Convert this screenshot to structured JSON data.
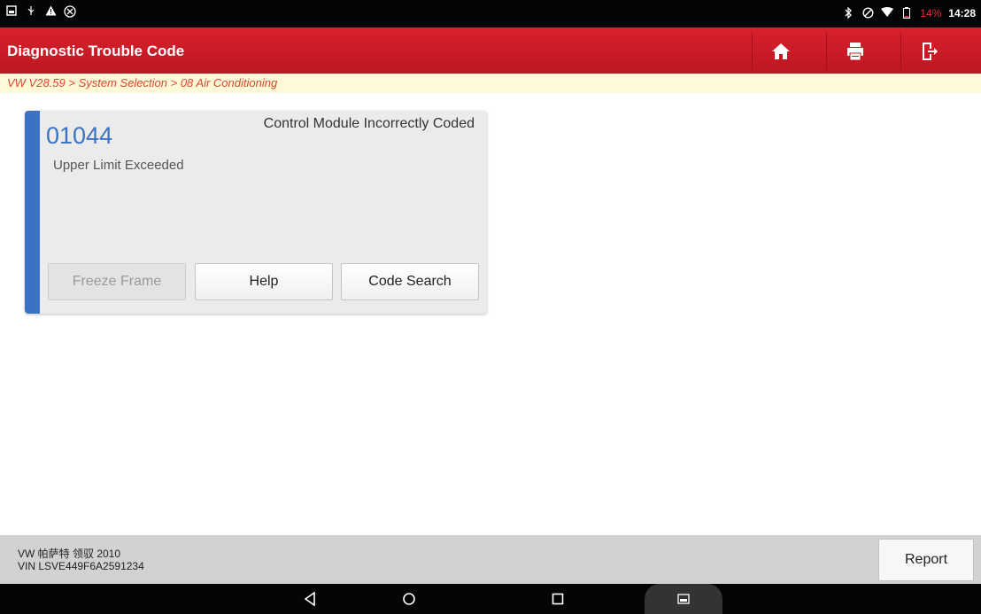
{
  "status_bar": {
    "left_icons": [
      "gallery-icon",
      "usb-icon",
      "warning-icon",
      "blocked-icon"
    ],
    "right_icons": [
      "bluetooth-icon",
      "do-not-disturb-icon",
      "wifi-icon",
      "battery-icon"
    ],
    "battery_percent": "14%",
    "time": "14:28"
  },
  "header": {
    "title": "Diagnostic Trouble Code",
    "buttons": [
      {
        "name": "home",
        "icon": "home-icon"
      },
      {
        "name": "print",
        "icon": "print-icon"
      },
      {
        "name": "exit",
        "icon": "exit-icon"
      }
    ]
  },
  "breadcrumb": "VW V28.59 > System Selection > 08 Air Conditioning",
  "dtc": {
    "code": "01044",
    "title": "Control Module Incorrectly Coded",
    "status": "Upper Limit Exceeded",
    "buttons": {
      "freeze_frame": "Freeze Frame",
      "help": "Help",
      "code_search": "Code Search"
    }
  },
  "footer": {
    "vehicle": "VW 帕萨特 领驭 2010",
    "vin": "VIN LSVE449F6A2591234",
    "report_label": "Report"
  },
  "navigation": {
    "buttons": [
      "back-icon",
      "home-circle-icon",
      "recents-icon",
      "screenshot-icon"
    ]
  },
  "colors": {
    "header_red": "#d9202c",
    "accent_blue": "#3a72c4",
    "breadcrumb_text": "#e0452e",
    "breadcrumb_bg": "#fff9d8",
    "battery_low": "#e0303b"
  }
}
